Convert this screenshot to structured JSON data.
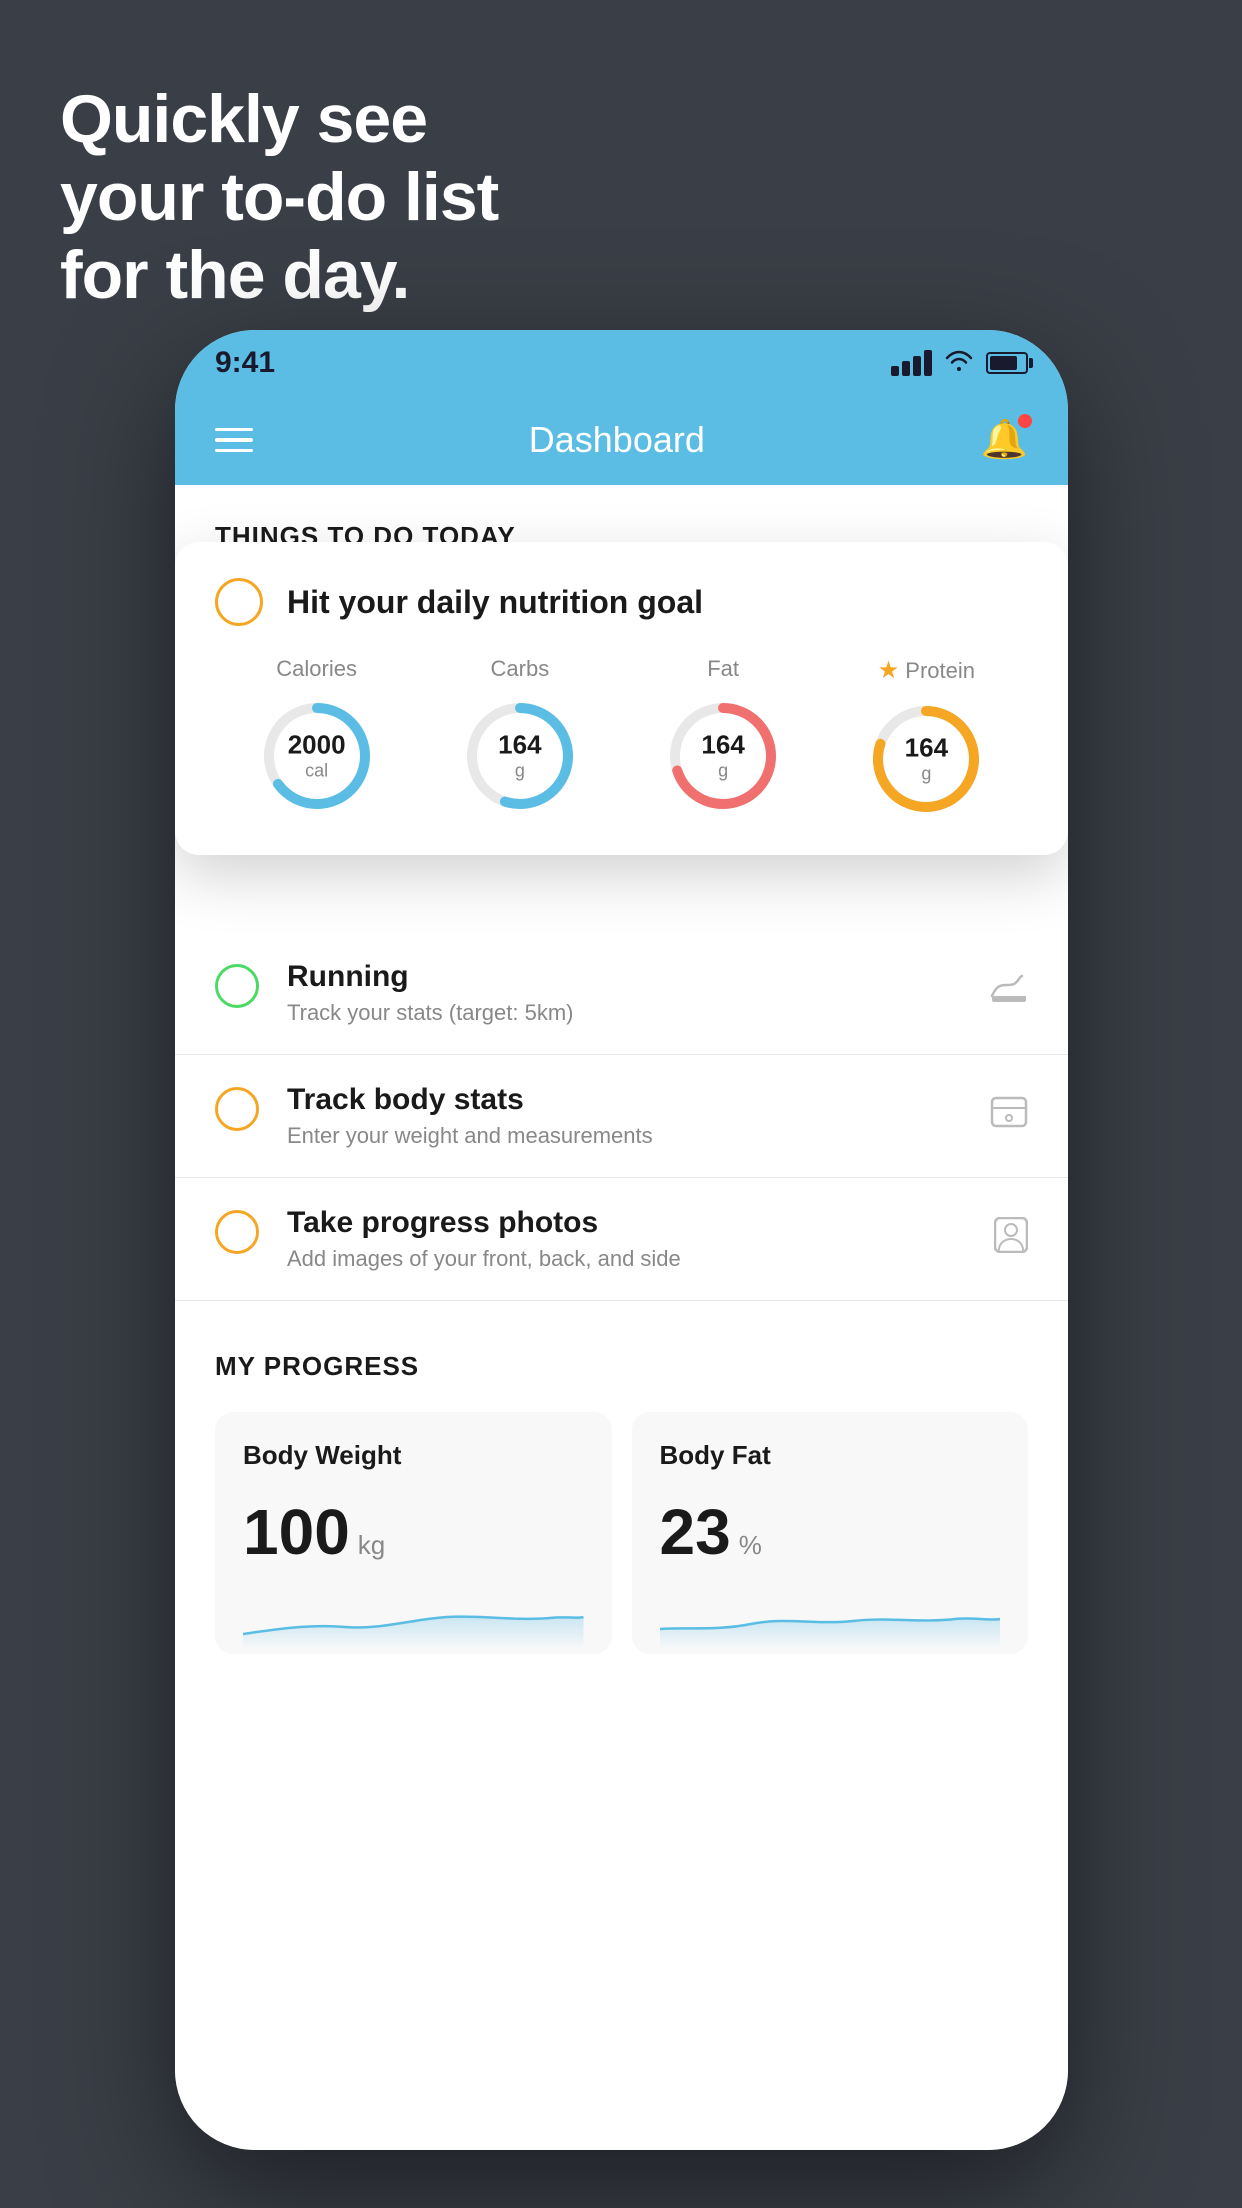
{
  "background_color": "#3a3f47",
  "headline": {
    "line1": "Quickly see",
    "line2": "your to-do list",
    "line3": "for the day.",
    "full_text": "Quickly see\nyour to-do list\nfor the day."
  },
  "status_bar": {
    "time": "9:41"
  },
  "nav_bar": {
    "title": "Dashboard"
  },
  "floating_card": {
    "title": "Hit your daily nutrition goal",
    "nutrition": [
      {
        "label": "Calories",
        "value": "2000",
        "unit": "cal",
        "color": "#5bbde4",
        "percent": 65
      },
      {
        "label": "Carbs",
        "value": "164",
        "unit": "g",
        "color": "#5bbde4",
        "percent": 55
      },
      {
        "label": "Fat",
        "value": "164",
        "unit": "g",
        "color": "#f07070",
        "percent": 70
      },
      {
        "label": "Protein",
        "value": "164",
        "unit": "g",
        "color": "#f5a623",
        "percent": 80,
        "starred": true
      }
    ]
  },
  "todo_items": [
    {
      "title": "Running",
      "subtitle": "Track your stats (target: 5km)",
      "circle_color": "green",
      "icon": "shoe"
    },
    {
      "title": "Track body stats",
      "subtitle": "Enter your weight and measurements",
      "circle_color": "yellow",
      "icon": "scale"
    },
    {
      "title": "Take progress photos",
      "subtitle": "Add images of your front, back, and side",
      "circle_color": "yellow",
      "icon": "person"
    }
  ],
  "progress_section": {
    "header": "MY PROGRESS",
    "cards": [
      {
        "title": "Body Weight",
        "value": "100",
        "unit": "kg"
      },
      {
        "title": "Body Fat",
        "value": "23",
        "unit": "%"
      }
    ]
  }
}
